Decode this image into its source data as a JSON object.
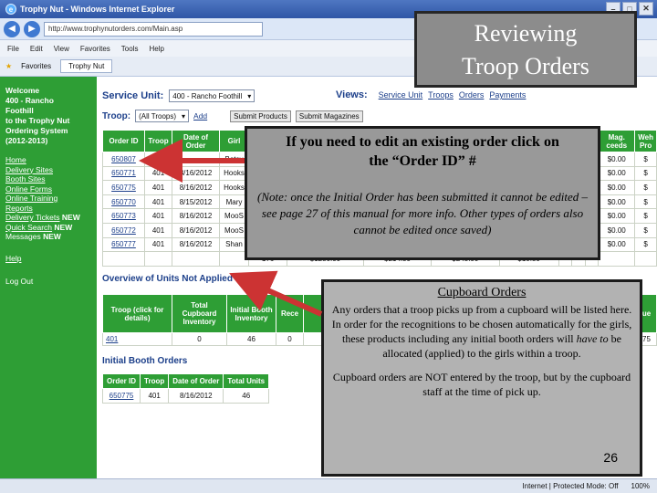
{
  "window": {
    "title": "Trophy Nut - Windows Internet Explorer",
    "url": "http://www.trophynutorders.com/Main.asp"
  },
  "menu": [
    "File",
    "Edit",
    "View",
    "Favorites",
    "Tools",
    "Help"
  ],
  "favbar": {
    "favorites": "Favorites",
    "tab": "Trophy Nut"
  },
  "sidebar": {
    "welcome": [
      "Welcome",
      "400 - Rancho",
      "Foothill",
      "to the Trophy Nut",
      "Ordering System",
      "(2012-2013)"
    ],
    "nav": [
      {
        "label": "Home"
      },
      {
        "label": "Delivery Sites"
      },
      {
        "label": "Booth Sites"
      },
      {
        "label": "Online Forms"
      },
      {
        "label": "Online Training"
      },
      {
        "label": "Reports"
      },
      {
        "label": "Delivery Tickets",
        "badge": "NEW"
      },
      {
        "label": "Quick Search",
        "badge": "NEW"
      },
      {
        "label": "Messages",
        "badge": "NEW"
      }
    ],
    "help": "Help",
    "logout": "Log Out"
  },
  "main": {
    "service_unit_label": "Service Unit:",
    "service_unit_value": "400 - Rancho Foothill",
    "views_label": "Views:",
    "views": [
      "Service Unit",
      "Troops",
      "Orders",
      "Payments"
    ],
    "troop_label": "Troop:",
    "troop_value": "(All Troops)",
    "add_link": "Add",
    "submit_products": "Submit Products",
    "submit_magazines": "Submit Magazines"
  },
  "orders_table": {
    "headers": [
      "Order ID",
      "Troop",
      "Date of Order",
      "Girl",
      "",
      "",
      "",
      "",
      "",
      "",
      "",
      "",
      "Mag. ceeds",
      "Weh Pro"
    ],
    "rows": [
      {
        "id": "650807",
        "troop": "",
        "date": "",
        "girl": "Betsy",
        "mag": "$0.00"
      },
      {
        "id": "650771",
        "troop": "401",
        "date": "8/16/2012",
        "girl": "Hooks",
        "mag": "$0.00"
      },
      {
        "id": "650775",
        "troop": "401",
        "date": "8/16/2012",
        "girl": "Hooks",
        "mag": "$0.00"
      },
      {
        "id": "650770",
        "troop": "401",
        "date": "8/15/2012",
        "girl": "Mary",
        "mag": "$0.00"
      },
      {
        "id": "650773",
        "troop": "401",
        "date": "8/16/2012",
        "girl": "MooS",
        "mag": "$0.00"
      },
      {
        "id": "650772",
        "troop": "401",
        "date": "8/16/2012",
        "girl": "MooS",
        "mag": "$0.00"
      },
      {
        "id": "650777",
        "troop": "401",
        "date": "8/16/2012",
        "girl": "Shan",
        "mag": "$0.00"
      }
    ],
    "total_row": {
      "a": "176",
      "b": "$1280.00",
      "c": "$214.50",
      "d": "$245.00",
      "e": "$10.50"
    }
  },
  "units_section": {
    "title": "Overview of Units Not Applied",
    "headers": [
      "Troop (click for details)",
      "Total Cupboard Inventory",
      "Initial Booth Inventory",
      "Rece",
      "",
      "",
      "",
      "",
      "",
      "",
      "",
      "ue"
    ],
    "row": {
      "troop": "401",
      "cupboard": "0",
      "booth": "46",
      "rece": "0",
      "last": "75"
    }
  },
  "booth_section": {
    "title": "Initial Booth Orders",
    "headers": [
      "Order ID",
      "Troop",
      "Date of Order",
      "Total Units"
    ],
    "row": {
      "id": "650775",
      "troop": "401",
      "date": "8/16/2012",
      "units": "46"
    }
  },
  "statusbar": {
    "zone": "Internet | Protected Mode: Off",
    "zoom": "100%"
  },
  "callouts": {
    "title_line1": "Reviewing",
    "title_line2": "Troop Orders",
    "edit_line1": "If you need to edit an existing order click on",
    "edit_line2": "the “Order ID” #",
    "edit_note": "(Note: once the Initial Order has been submitted it cannot be edited – see page 27 of this manual for more info. Other types of orders also cannot be edited once saved)",
    "cup_title": "Cupboard Orders",
    "cup_p1_a": "Any orders that a troop picks up from a cupboard will be listed here. In order for the recognitions to be chosen automatically for the girls, these products including any initial booth orders will",
    "cup_p1_em": "have to",
    "cup_p1_b": "be allocated (applied) to the girls within a troop.",
    "cup_p2": "Cupboard orders are NOT entered by the troop, but by the cupboard staff at the time of pick up.",
    "page_number": "26"
  }
}
